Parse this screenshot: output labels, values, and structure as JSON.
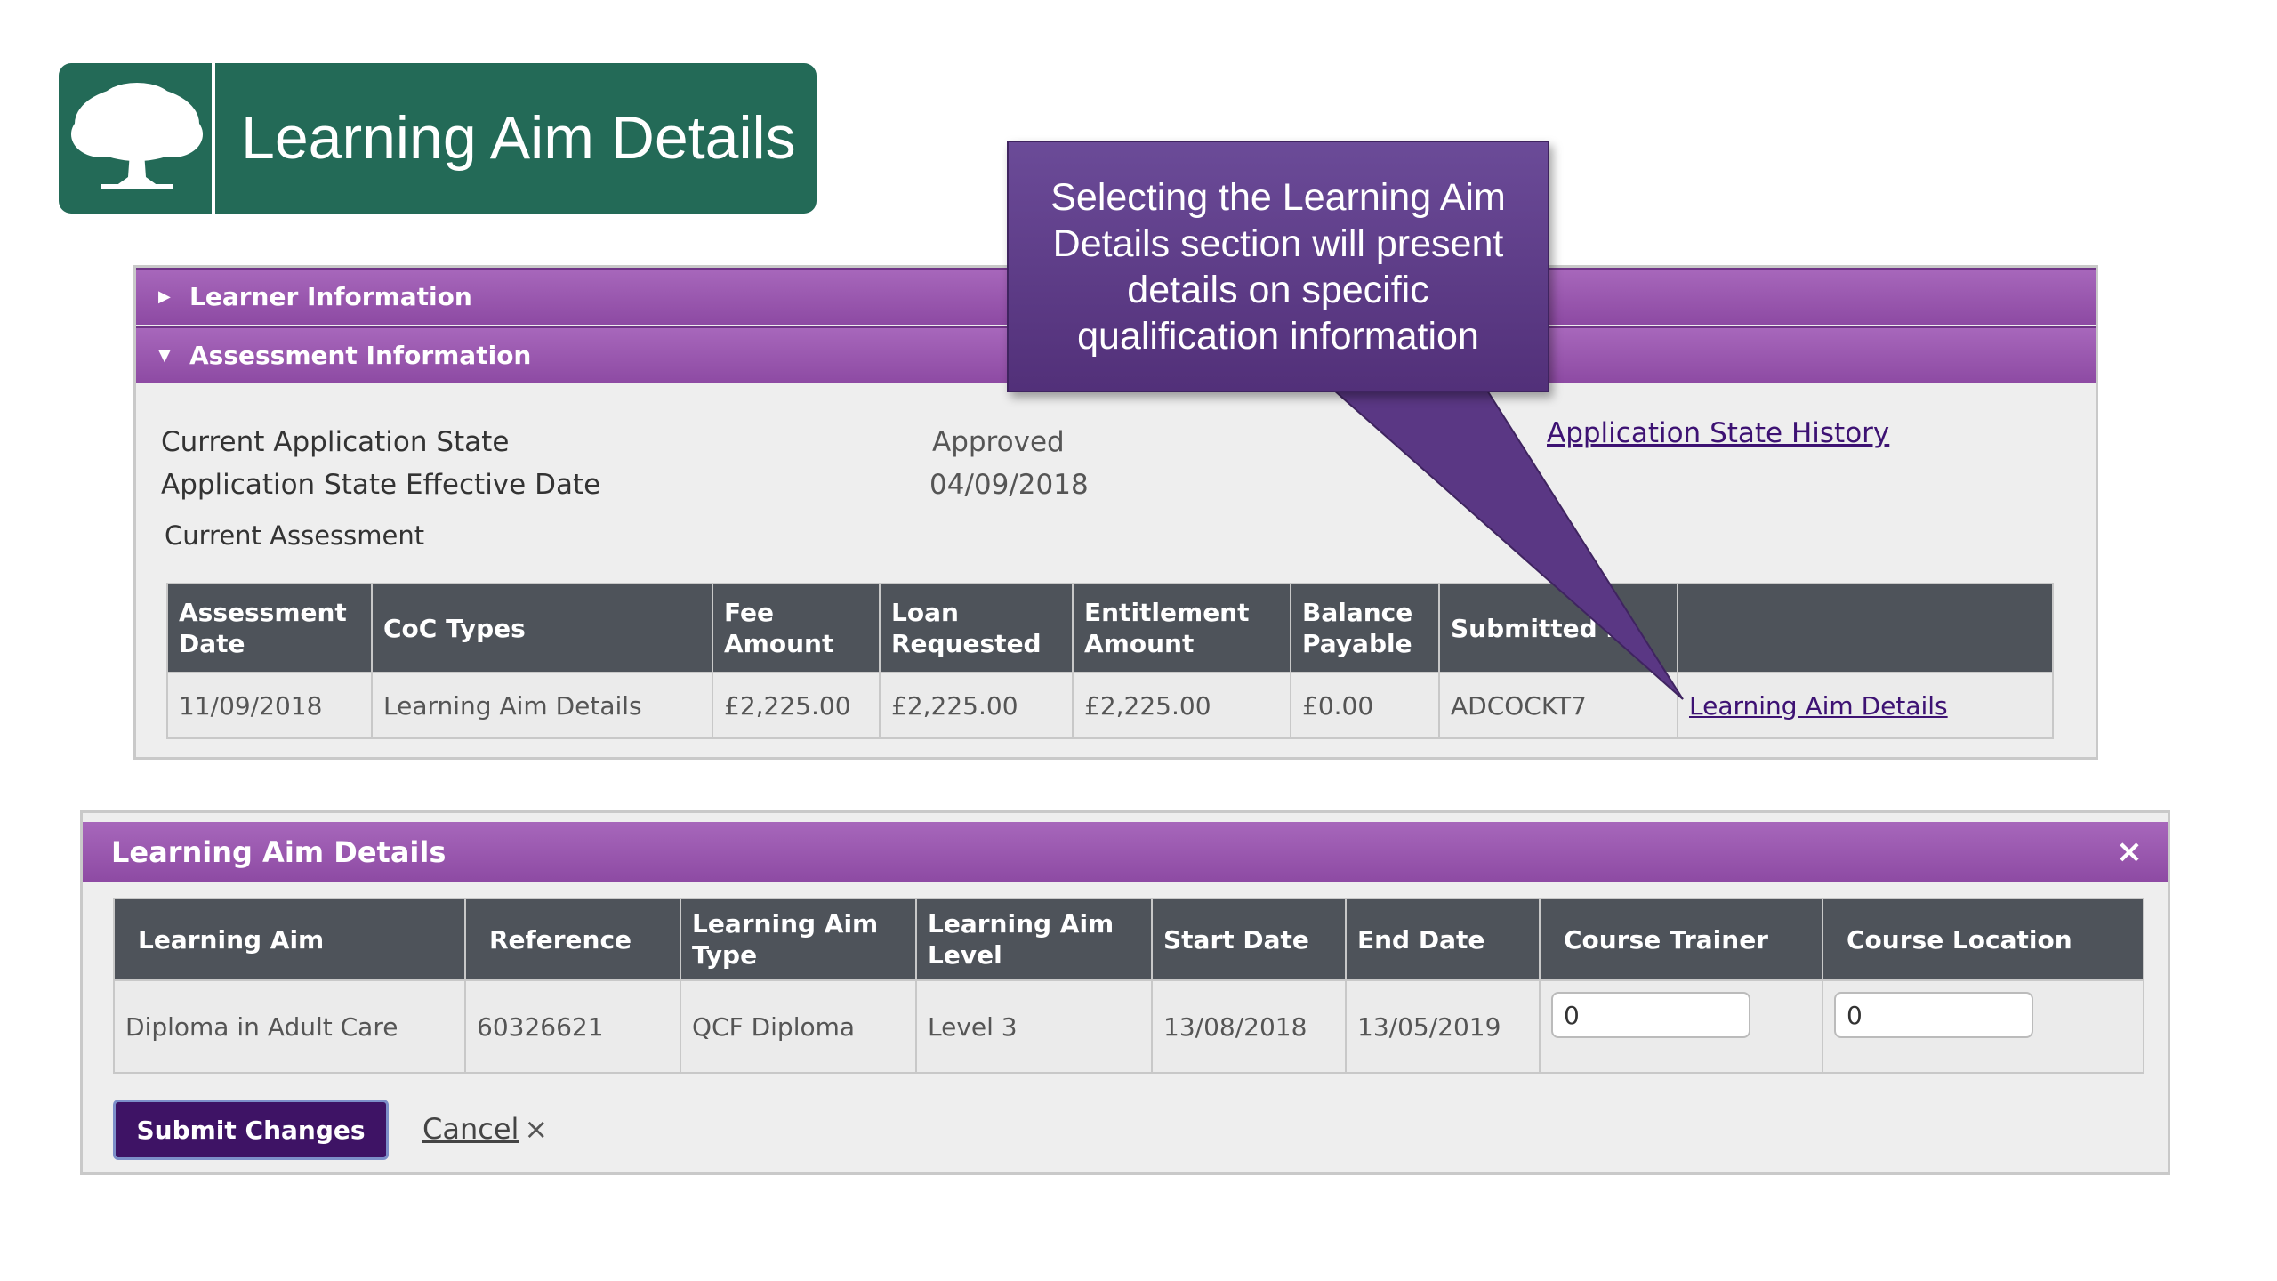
{
  "banner": {
    "title": "Learning Aim Details"
  },
  "accordion": {
    "learner_information": "Learner Information",
    "assessment_information": "Assessment Information"
  },
  "assessment": {
    "current_state_label": "Current Application State",
    "current_state_value": "Approved",
    "effective_date_label": "Application State Effective Date",
    "effective_date_value": "04/09/2018",
    "history_link": "Application State History",
    "current_assessment_label": "Current Assessment",
    "table": {
      "headers": [
        "Assessment Date",
        "CoC Types",
        "Fee Amount",
        "Loan Requested",
        "Entitlement Amount",
        "Balance Payable",
        "Submitted b",
        ""
      ],
      "row": [
        "11/09/2018",
        "Learning Aim Details",
        "£2,225.00",
        "£2,225.00",
        "£2,225.00",
        "£0.00",
        "ADCOCKT7",
        "Learning Aim Details"
      ]
    }
  },
  "callout": {
    "lines": [
      "Selecting the Learning Aim",
      "Details section will present",
      "details on specific",
      "qualification information"
    ]
  },
  "dialog": {
    "title": "Learning Aim Details",
    "close_icon": "×",
    "table": {
      "headers": [
        "Learning Aim",
        "Reference",
        "Learning Aim Type",
        "Learning Aim Level",
        "Start Date",
        "End Date",
        "Course Trainer",
        "Course Location"
      ],
      "row": [
        "Diploma in Adult Care",
        "60326621",
        "QCF Diploma",
        "Level 3",
        "13/08/2018",
        "13/05/2019"
      ]
    },
    "course_trainer_value": "0",
    "course_location_value": "0",
    "submit_label": "Submit Changes",
    "cancel_label": "Cancel",
    "cancel_icon": "×"
  },
  "icons": {
    "logo": "oak-tree-icon",
    "collapsed": "triangle-right-icon",
    "expanded": "triangle-down-icon"
  },
  "colors": {
    "banner": "#236a57",
    "accordion": "#9a58b0",
    "callout": "#5d3c88",
    "header_cell": "#4e535a",
    "submit": "#3e1365"
  }
}
